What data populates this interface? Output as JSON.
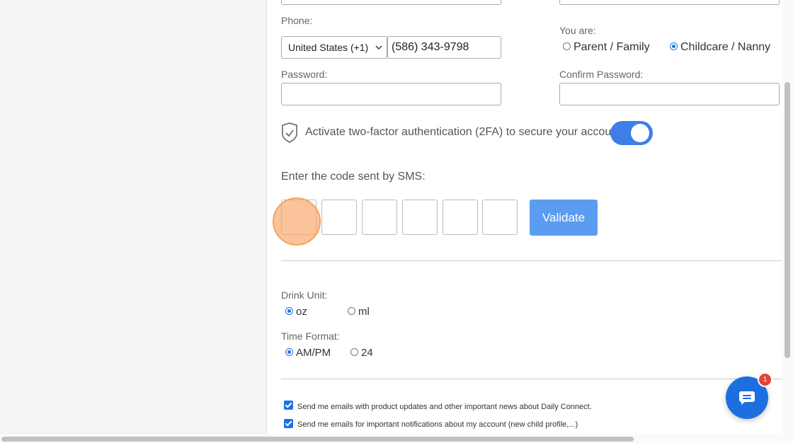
{
  "phone": {
    "label": "Phone:",
    "country": "United States (+1)",
    "number": "(586) 343-9798"
  },
  "role": {
    "label": "You are:",
    "options": [
      "Parent / Family",
      "Childcare / Nanny"
    ],
    "selected": "Childcare / Nanny"
  },
  "password": {
    "label": "Password:",
    "value": ""
  },
  "confirm_password": {
    "label": "Confirm Password:",
    "value": ""
  },
  "two_factor": {
    "text": "Activate two-factor authentication (2FA) to secure your account.",
    "enabled": true
  },
  "sms": {
    "label": "Enter the code sent by SMS:",
    "digits": [
      "",
      "",
      "",
      "",
      "",
      ""
    ],
    "validate_label": "Validate"
  },
  "drink_unit": {
    "label": "Drink Unit:",
    "options": [
      "oz",
      "ml"
    ],
    "selected": "oz"
  },
  "time_format": {
    "label": "Time Format:",
    "options": [
      "AM/PM",
      "24"
    ],
    "selected": "AM/PM"
  },
  "emails": [
    {
      "label": "Send me emails with product updates and other important news about Daily Connect.",
      "checked": true
    },
    {
      "label": "Send me emails for important notifications about my account (new child profile,...)",
      "checked": true
    }
  ],
  "chat": {
    "badge_count": "1"
  },
  "colors": {
    "accent": "#1a73e8",
    "validate_bg": "#5b9cf0",
    "toggle_on": "#3d7ee8",
    "chat_bg": "#1d6fe0",
    "badge": "#e34234",
    "cursor": "#f5a25d"
  }
}
